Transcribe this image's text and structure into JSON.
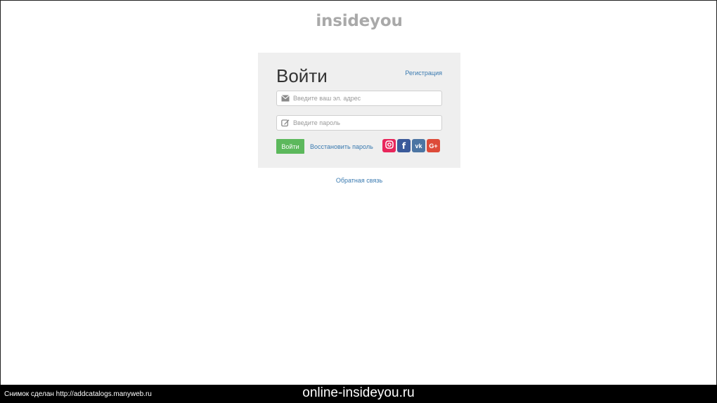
{
  "header": {
    "brand": "insideyou"
  },
  "login": {
    "title": "Войти",
    "register_link": "Регистрация",
    "email": {
      "placeholder": "Введите ваш эл. адрес",
      "value": "",
      "icon": "envelope-icon"
    },
    "password": {
      "placeholder": "Введите пароль",
      "value": "",
      "icon": "edit-icon"
    },
    "submit_label": "Войти",
    "restore_link": "Восстановить пароль",
    "social": [
      {
        "name": "instagram",
        "label": "",
        "color": "#e8265b"
      },
      {
        "name": "facebook",
        "label": "f",
        "color": "#3b5a9a"
      },
      {
        "name": "vk",
        "label": "vk",
        "color": "#4c75a3"
      },
      {
        "name": "google-plus",
        "label": "G+",
        "color": "#dd4b39"
      }
    ]
  },
  "feedback_link": "Обратная связь",
  "footer": {
    "snapshot_text": "Снимок сделан http://addcatalogs.manyweb.ru",
    "site": "online-insideyou.ru"
  },
  "colors": {
    "accent_green": "#5cb85c",
    "link": "#3a7ab0",
    "panel_bg": "#efefef",
    "brand_gray": "#a9a9a9"
  }
}
